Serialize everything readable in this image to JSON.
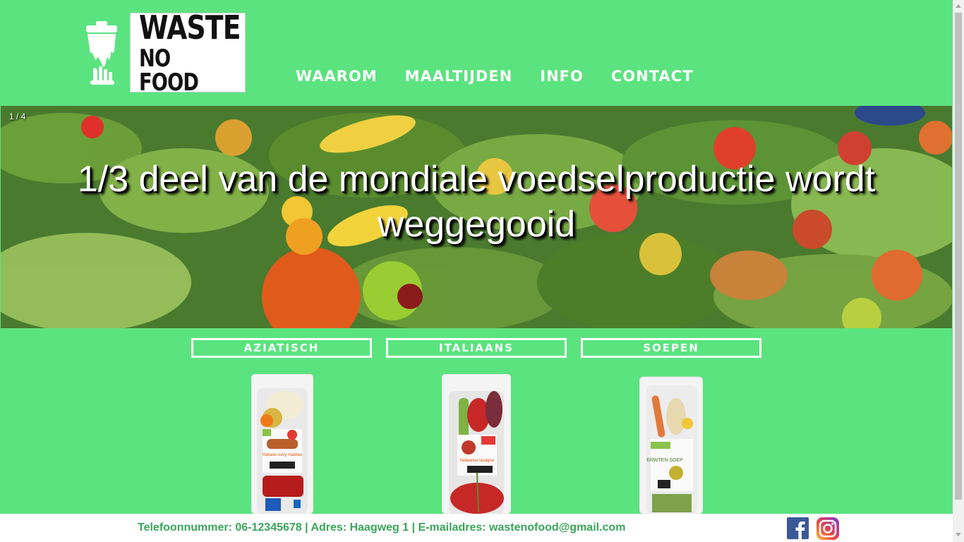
{
  "header": {
    "logo_line1": "WASTE",
    "logo_line2": "NO FOOD",
    "nav": [
      {
        "label": "WAAROM"
      },
      {
        "label": "MAALTIJDEN"
      },
      {
        "label": "INFO"
      },
      {
        "label": "CONTACT"
      }
    ]
  },
  "hero": {
    "counter": "1 / 4",
    "caption": "1/3 deel van de mondiale voedselproductie wordt weggegooid"
  },
  "categories": [
    {
      "label": "AZIATISCH"
    },
    {
      "label": "ITALIAANS"
    },
    {
      "label": "SOEPEN"
    }
  ],
  "products": [
    {
      "name": "Indiase curry madras"
    },
    {
      "name": "Italiaanse lasagne"
    },
    {
      "name": "ERWTEN SOEP"
    }
  ],
  "footer": {
    "contact": "Telefoonnummer: 06-12345678 | Adres: Haagweg 1 | E-mailadres: wastenofood@gmail.com",
    "social": [
      {
        "icon": "facebook-icon",
        "color": "#3b5998"
      },
      {
        "icon": "instagram-icon",
        "color": "#c13584"
      }
    ]
  },
  "colors": {
    "background": "#5be37f",
    "footer_text": "#3aa55a"
  }
}
